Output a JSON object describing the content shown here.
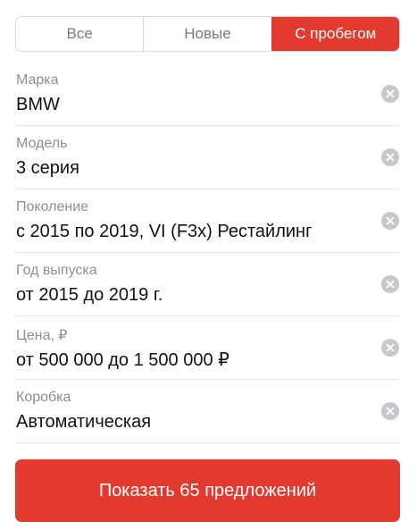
{
  "tabs": [
    {
      "label": "Все",
      "active": false
    },
    {
      "label": "Новые",
      "active": false
    },
    {
      "label": "С пробегом",
      "active": true
    }
  ],
  "fields": [
    {
      "label": "Марка",
      "value": "BMW"
    },
    {
      "label": "Модель",
      "value": "3 серия"
    },
    {
      "label": "Поколение",
      "value": "с 2015 по 2019, VI (F3x) Рестайлинг"
    },
    {
      "label": "Год выпуска",
      "value": "от 2015 до 2019 г."
    },
    {
      "label": "Цена, ₽",
      "value": "от 500 000 до 1 500 000 ₽"
    },
    {
      "label": "Коробка",
      "value": "Автоматическая"
    }
  ],
  "clear_icon": "clear-x-circle-icon",
  "submit_label": "Показать 65 предложений",
  "colors": {
    "accent": "#e23a2e",
    "label_gray": "#8e8e93",
    "clear_gray": "#c7c7cc",
    "divider": "#e4e4e4"
  }
}
